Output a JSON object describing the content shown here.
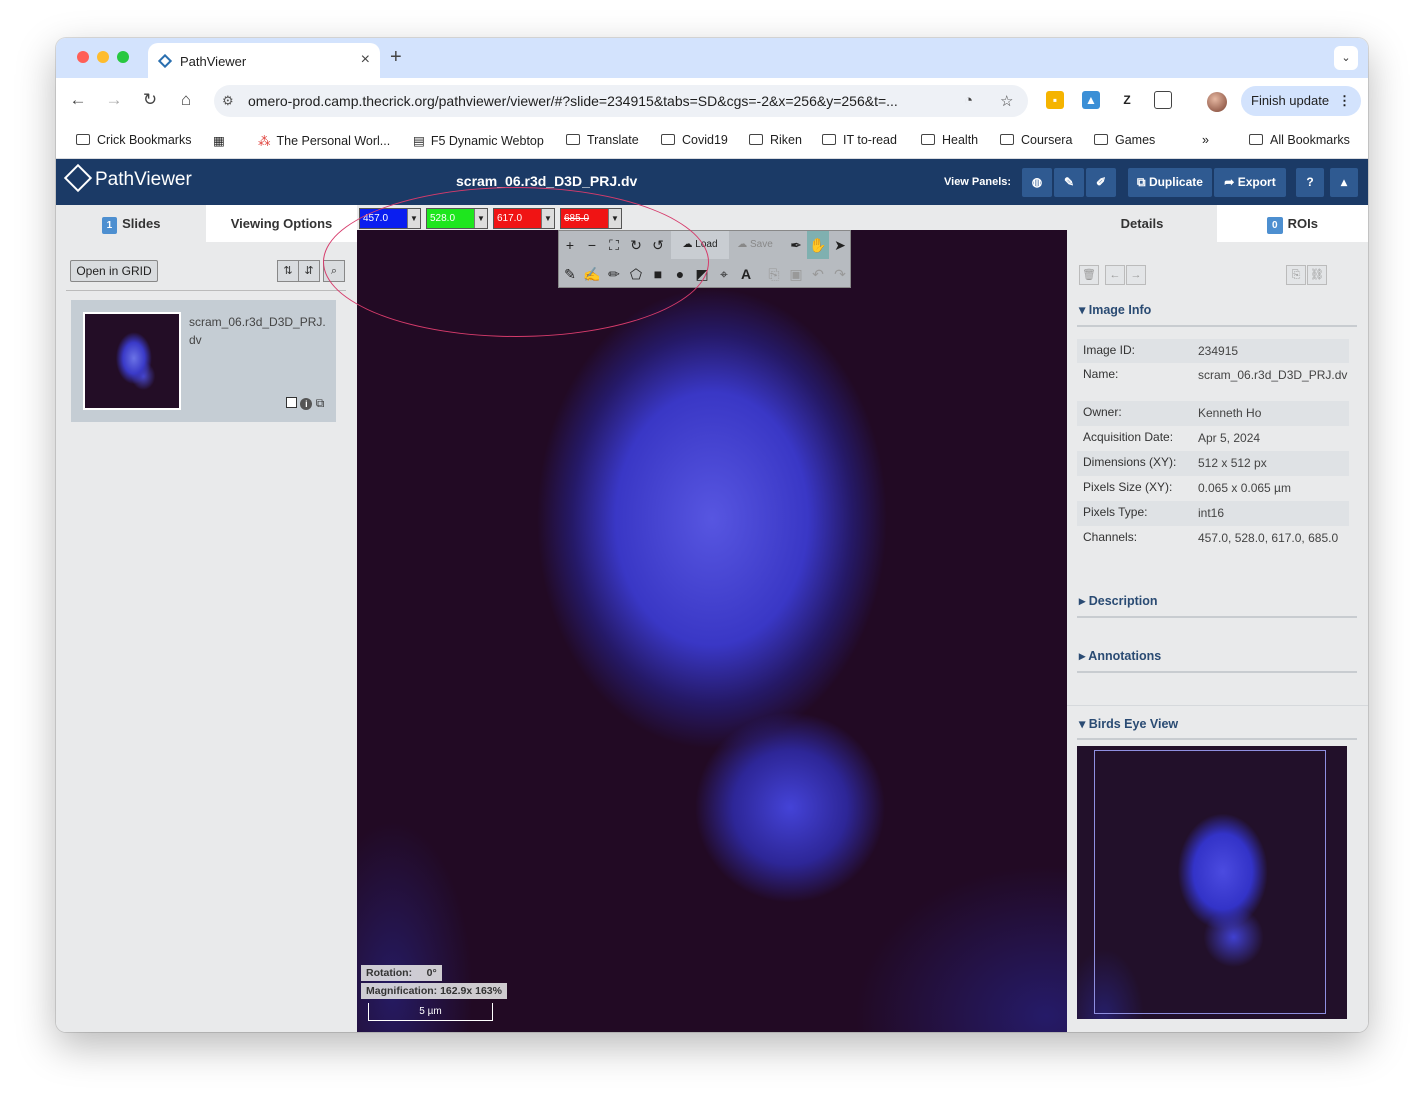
{
  "browser": {
    "tab_title": "PathViewer",
    "url": "omero-prod.camp.thecrick.org/pathviewer/viewer/#?slide=234915&tabs=SD&cgs=-2&x=256&y=256&t=...",
    "finish_update": "Finish update",
    "bookmarks": [
      "Crick Bookmarks",
      "The Personal Worl...",
      "F5 Dynamic Webtop",
      "Translate",
      "Covid19",
      "Riken",
      "IT to-read",
      "Health",
      "Coursera",
      "Games"
    ],
    "bookmarks_overflow": "»",
    "all_bookmarks": "All Bookmarks"
  },
  "app": {
    "logo": "PathViewer",
    "image_title": "scram_06.r3d_D3D_PRJ.dv",
    "view_panels_label": "View Panels:",
    "duplicate": "Duplicate",
    "export": "Export",
    "help": "?"
  },
  "left": {
    "slides_count": "1",
    "slides_label": "Slides",
    "viewing_options": "Viewing Options",
    "open_in_grid": "Open in GRID",
    "slide_name": "scram_06.r3d_D3D_PRJ.dv"
  },
  "channels": [
    {
      "value": "457.0",
      "color": "#0a1ef0"
    },
    {
      "value": "528.0",
      "color": "#1ee61e"
    },
    {
      "value": "617.0",
      "color": "#f01414"
    },
    {
      "value": "685.0",
      "color": "#f01414"
    }
  ],
  "toolbox": {
    "load": "Load",
    "save": "Save"
  },
  "viewer": {
    "rotation_label": "Rotation:",
    "rotation_value": "0°",
    "magnification_label": "Magnification:",
    "magnification_value": "162.9x 163%",
    "scale": "5 µm"
  },
  "right": {
    "details_tab": "Details",
    "rois_count": "0",
    "rois_label": "ROIs",
    "image_info_h": "Image Info",
    "info": [
      {
        "k": "Image ID:",
        "v": "234915"
      },
      {
        "k": "Name:",
        "v": "scram_06.r3d_D3D_PRJ.dv"
      },
      {
        "k": "Owner:",
        "v": "Kenneth Ho"
      },
      {
        "k": "Acquisition Date:",
        "v": "Apr 5, 2024"
      },
      {
        "k": "Dimensions (XY):",
        "v": "512 x 512 px"
      },
      {
        "k": "Pixels Size (XY):",
        "v": "0.065 x 0.065 µm"
      },
      {
        "k": "Pixels Type:",
        "v": "int16"
      },
      {
        "k": "Channels:",
        "v": "457.0, 528.0, 617.0, 685.0"
      }
    ],
    "description_h": "Description",
    "annotations_h": "Annotations",
    "birds_eye_h": "Birds Eye View"
  }
}
